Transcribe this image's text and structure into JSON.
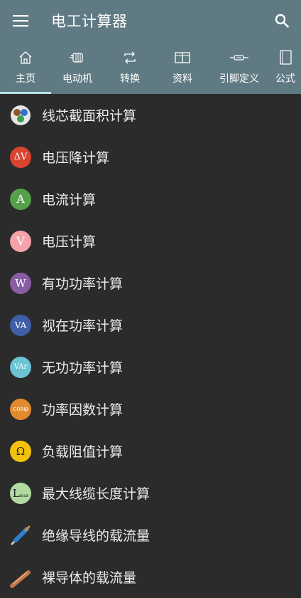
{
  "app": {
    "title": "电工计算器"
  },
  "tabs": [
    {
      "label": "主页",
      "icon": "home-icon",
      "active": true
    },
    {
      "label": "电动机",
      "icon": "motor-icon"
    },
    {
      "label": "转换",
      "icon": "convert-icon"
    },
    {
      "label": "资料",
      "icon": "book-open-icon"
    },
    {
      "label": "引脚定义",
      "icon": "connector-icon"
    },
    {
      "label": "公式",
      "icon": "formula-book-icon"
    }
  ],
  "calculators": [
    {
      "label": "线芯截面积计算",
      "icon": "wire-cross-section-icon"
    },
    {
      "label": "电压降计算",
      "icon": "voltage-drop-icon",
      "glyph": "ΔV",
      "color": "#d9442f"
    },
    {
      "label": "电流计算",
      "icon": "current-icon",
      "glyph": "A",
      "color": "#55a04a"
    },
    {
      "label": "电压计算",
      "icon": "voltage-icon",
      "glyph": "V",
      "color": "#f3a3a9"
    },
    {
      "label": "有功功率计算",
      "icon": "active-power-icon",
      "glyph": "W",
      "color": "#8a5ca3"
    },
    {
      "label": "视在功率计算",
      "icon": "apparent-power-icon",
      "glyph": "VA",
      "color": "#3e5fa8"
    },
    {
      "label": "无功功率计算",
      "icon": "reactive-power-icon",
      "glyph": "VAr",
      "color": "#6cc3d4"
    },
    {
      "label": "功率因数计算",
      "icon": "power-factor-icon",
      "glyph": "cosφ",
      "color": "#e38a2e"
    },
    {
      "label": "负载阻值计算",
      "icon": "resistance-icon",
      "glyph": "Ω",
      "color": "#f4c20d"
    },
    {
      "label": "最大线缆长度计算",
      "icon": "max-cable-length-icon",
      "glyph": "L",
      "sub": "max",
      "color": "#b2dba1"
    },
    {
      "label": "绝缘导线的载流量",
      "icon": "insulated-wire-icon"
    },
    {
      "label": "裸导体的载流量",
      "icon": "bare-conductor-icon"
    }
  ]
}
